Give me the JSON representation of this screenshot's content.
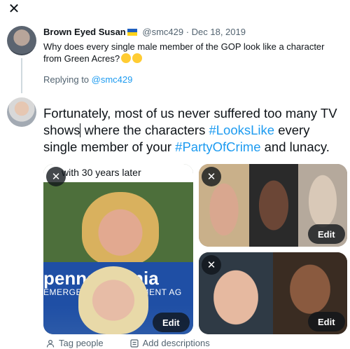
{
  "header": {
    "close_glyph": "✕"
  },
  "original_tweet": {
    "author_name": "Brown Eyed Susan",
    "handle_date": "@smc429 · Dec 18, 2019",
    "text": "Why does every single male member of the GOP look like a character from Green Acres?"
  },
  "reply_context": {
    "prefix": "Replying to ",
    "handle": "@smc429"
  },
  "compose": {
    "part1": "Fortunately, most of us never suffered too many TV shows",
    "part2": " where the characters ",
    "hashtag1": "#LooksLike",
    "part3": " every single member of your ",
    "hashtag2": "#PartyOfCrime",
    "part4": " and lunacy."
  },
  "media": {
    "a_caption": "with 30 years later",
    "a_sign_line1": "pennsylvania",
    "a_sign_line2": "EMERGENCY MANAGEMENT AG",
    "remove_glyph": "✕",
    "edit_label": "Edit"
  },
  "tools": {
    "tag_people": "Tag people",
    "add_descriptions": "Add descriptions"
  },
  "colors": {
    "accent": "#1d9bf0",
    "text": "#0f1419",
    "muted": "#536471"
  },
  "icons": [
    "close-icon",
    "flag-icon",
    "emoji-icon",
    "person-icon",
    "description-icon"
  ]
}
